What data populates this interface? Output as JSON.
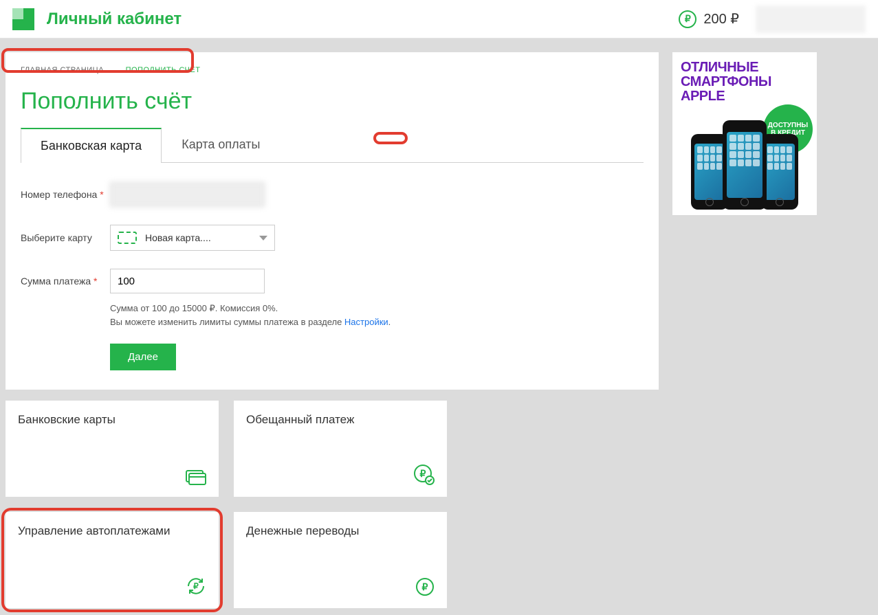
{
  "header": {
    "site_title": "Личный кабинет",
    "balance": "200 ₽",
    "ruble_symbol": "₽"
  },
  "breadcrumbs": {
    "home": "ГЛАВНАЯ СТРАНИЦА",
    "arrow": "→",
    "current": "ПОПОЛНИТЬ СЧЁТ"
  },
  "page": {
    "title": "Пополнить счёт"
  },
  "tabs": {
    "bank_card": "Банковская карта",
    "pay_card": "Карта оплаты"
  },
  "form": {
    "phone_label": "Номер телефона",
    "card_label": "Выберите карту",
    "card_selected": "Новая карта....",
    "amount_label": "Сумма платежа",
    "amount_value": "100",
    "hint_line1": "Сумма от 100 до 15000 ₽. Комиссия 0%.",
    "hint_line2_prefix": "Вы можете изменить лимиты суммы платежа в разделе ",
    "hint_link": "Настройки",
    "submit": "Далее"
  },
  "tiles": {
    "bank_cards": "Банковские карты",
    "promised_payment": "Обещанный платеж",
    "autopay": "Управление автоплатежами",
    "transfers": "Денежные переводы"
  },
  "ad": {
    "line1": "ОТЛИЧНЫЕ",
    "line2": "СМАРТФОНЫ",
    "line3": "APPLE",
    "badge_line1": "ДОСТУПНЫ",
    "badge_line2": "В КРЕДИТ"
  }
}
